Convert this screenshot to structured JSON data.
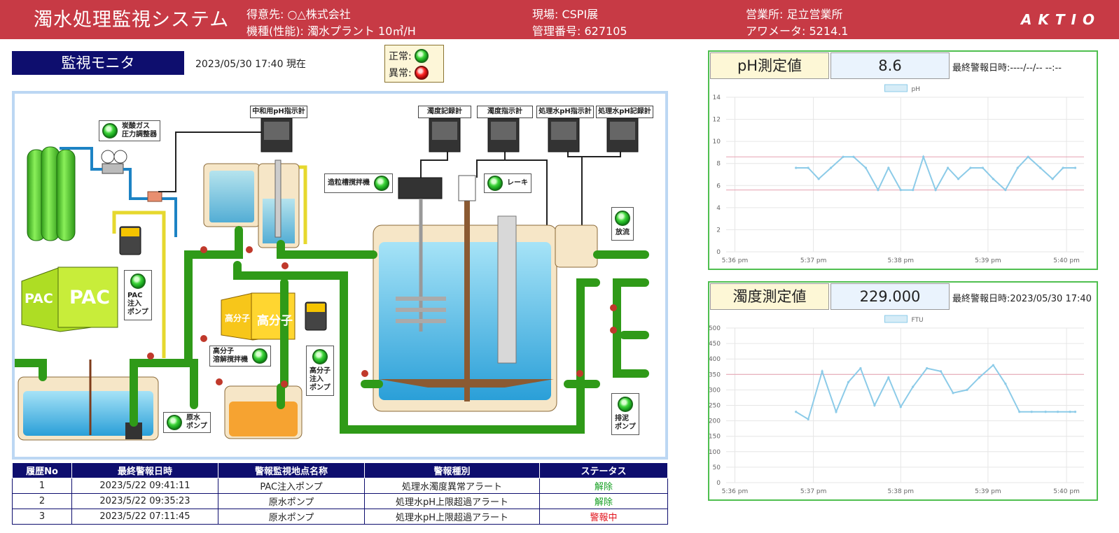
{
  "header": {
    "title": "濁水処理監視システム",
    "customer": "得意先: ○△株式会社",
    "model": "機種(性能): 濁水プラント 10㎥/H",
    "site": "現場: CSPI展",
    "mgmt_no": "管理番号: 627105",
    "office": "営業所: 足立営業所",
    "hour_meter": "アワメータ: 5214.1",
    "logo": "AKTIO"
  },
  "monitor": {
    "title": "監視モニタ",
    "datetime": "2023/05/30 17:40 現在",
    "legend_normal": "正常:",
    "legend_abnormal": "異常:"
  },
  "diagram": {
    "co2_regulator": "炭酸ガス\n圧力調整器",
    "ph_meter_neutral": "中和用pH指示計",
    "turbidity_recorder": "濁度記録計",
    "turbidity_indicator": "濁度指示計",
    "treated_ph_indicator": "処理水pH指示計",
    "treated_ph_recorder": "処理水pH記録計",
    "granulation_mixer": "造粒槽撹拌機",
    "rake": "レーキ",
    "discharge": "放流",
    "pac_pump": "PAC\n注入\nポンプ",
    "pac_tank_small": "PAC",
    "pac_tank_large": "PAC",
    "polymer_small": "高分子",
    "polymer_large": "高分子",
    "polymer_mixer": "高分子\n溶解撹拌機",
    "polymer_pump": "高分子\n注入\nポンプ",
    "raw_pump": "原水\nポンプ",
    "sludge_pump": "排泥\nポンプ"
  },
  "alerts": {
    "headers": [
      "履歴No",
      "最終警報日時",
      "警報監視地点名称",
      "警報種別",
      "ステータス"
    ],
    "rows": [
      {
        "no": "1",
        "datetime": "2023/5/22 09:41:11",
        "point": "PAC注入ポンプ",
        "type": "処理水濁度異常アラート",
        "status": "解除"
      },
      {
        "no": "2",
        "datetime": "2023/5/22 09:35:23",
        "point": "原水ポンプ",
        "type": "処理水pH上限超過アラート",
        "status": "解除"
      },
      {
        "no": "3",
        "datetime": "2023/5/22 07:11:45",
        "point": "原水ポンプ",
        "type": "処理水pH上限超過アラート",
        "status": "警報中"
      }
    ]
  },
  "ph_panel": {
    "label": "pH測定値",
    "value": "8.6",
    "last_alarm": "最終警報日時:----/--/-- --:--"
  },
  "turb_panel": {
    "label": "濁度測定値",
    "value": "229.000",
    "last_alarm": "最終警報日時:2023/05/30 17:40"
  },
  "chart_data": [
    {
      "type": "line",
      "series": [
        {
          "name": "pH",
          "x": [
            5.9,
            5.97,
            6.03,
            6.1,
            6.17,
            6.23,
            6.3,
            6.37,
            6.43,
            6.5,
            6.57,
            6.63,
            6.7,
            6.77,
            6.83,
            6.9,
            6.97,
            7.03,
            7.1,
            7.17,
            7.23,
            7.3,
            7.37,
            7.43,
            7.5
          ],
          "values": [
            7.6,
            7.6,
            6.6,
            7.6,
            8.6,
            8.6,
            7.6,
            5.6,
            7.6,
            5.6,
            5.6,
            8.6,
            5.6,
            7.6,
            6.6,
            7.6,
            7.6,
            6.6,
            5.6,
            7.6,
            8.6,
            7.6,
            6.6,
            7.6,
            7.6
          ]
        }
      ],
      "x_ticks": [
        "5:36 pm",
        "5:37 pm",
        "5:38 pm",
        "5:39 pm",
        "5:40 pm"
      ],
      "ylim": [
        0,
        14
      ],
      "y_ticks": [
        0,
        2,
        4,
        6,
        8,
        10,
        12,
        14
      ],
      "thresholds": [
        8.6,
        5.6
      ],
      "color": "#8ccbe8",
      "threshold_color": "#e6a0b0"
    },
    {
      "type": "line",
      "series": [
        {
          "name": "FTU",
          "x": [
            5.9,
            5.97,
            6.05,
            6.13,
            6.2,
            6.27,
            6.35,
            6.43,
            6.5,
            6.57,
            6.65,
            6.73,
            6.8,
            6.88,
            6.95,
            7.03,
            7.1,
            7.18,
            7.25,
            7.33,
            7.4,
            7.47,
            7.5
          ],
          "values": [
            229,
            205,
            360,
            229,
            325,
            370,
            250,
            340,
            245,
            310,
            370,
            360,
            290,
            300,
            340,
            380,
            320,
            229,
            229,
            229,
            229,
            229,
            229
          ]
        }
      ],
      "x_ticks": [
        "5:36 pm",
        "5:37 pm",
        "5:38 pm",
        "5:39 pm",
        "5:40 pm"
      ],
      "ylim": [
        0,
        500
      ],
      "y_ticks": [
        0,
        50,
        100,
        150,
        200,
        250,
        300,
        350,
        400,
        450,
        500
      ],
      "thresholds": [
        350
      ],
      "color": "#8ccbe8",
      "threshold_color": "#e6a0b0"
    }
  ]
}
